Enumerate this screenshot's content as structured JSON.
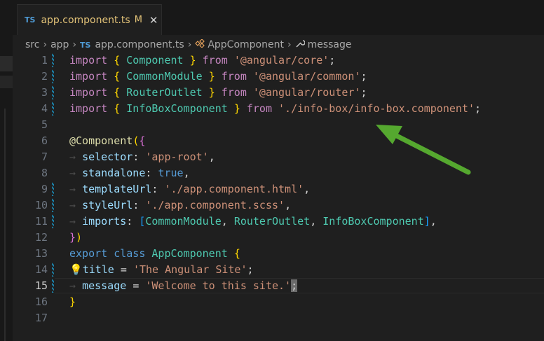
{
  "tab": {
    "lang_badge": "TS",
    "filename": "app.component.ts",
    "modified": "M",
    "close": "✕"
  },
  "breadcrumb": {
    "items": [
      "src",
      "app",
      "app.component.ts",
      "AppComponent",
      "message"
    ],
    "file_badge": "TS"
  },
  "editor": {
    "active_line": 15,
    "lines": [
      {
        "n": "1"
      },
      {
        "n": "2"
      },
      {
        "n": "3"
      },
      {
        "n": "4"
      },
      {
        "n": "5"
      },
      {
        "n": "6"
      },
      {
        "n": "7"
      },
      {
        "n": "8"
      },
      {
        "n": "9"
      },
      {
        "n": "10"
      },
      {
        "n": "11"
      },
      {
        "n": "12"
      },
      {
        "n": "13"
      },
      {
        "n": "14"
      },
      {
        "n": "15"
      },
      {
        "n": "16"
      },
      {
        "n": "17"
      }
    ],
    "code": {
      "import": "import",
      "from": "from",
      "lbrace": "{",
      "rbrace": "}",
      "semi": ";",
      "component": "Component",
      "common_module": "CommonModule",
      "router_outlet": "RouterOutlet",
      "info_box_component": "InfoBoxComponent",
      "angular_core": "'@angular/core'",
      "angular_common": "'@angular/common'",
      "angular_router": "'@angular/router'",
      "info_box_path": "'./info-box/info-box.component'",
      "decorator_at": "@",
      "decorator_name": "Component",
      "lparen": "(",
      "rparen": ")",
      "selector_key": "selector",
      "selector_val": "'app-root'",
      "standalone_key": "standalone",
      "standalone_val": "true",
      "template_key": "templateUrl",
      "template_val": "'./app.component.html'",
      "style_key": "styleUrl",
      "style_val": "'./app.component.scss'",
      "imports_key": "imports",
      "lbracket": "[",
      "rbracket": "]",
      "export": "export",
      "class": "class",
      "app_component": "AppComponent",
      "title_key": "title",
      "title_val": "'The Angular Site'",
      "message_key": "message",
      "message_val": "'Welcome to this site.'",
      "eq": "=",
      "colon": ":",
      "comma": ",",
      "ws_arrow": "→"
    }
  },
  "colors": {
    "keyword": "#569cd6",
    "control_keyword": "#c586c0",
    "string": "#ce9178",
    "type": "#4ec9b0",
    "property": "#9cdcfe",
    "arrow": "#55a82f"
  },
  "icons": {
    "lightbulb": "lightbulb-icon",
    "wrench": "wrench-icon",
    "class_symbol": "class-symbol-icon"
  }
}
